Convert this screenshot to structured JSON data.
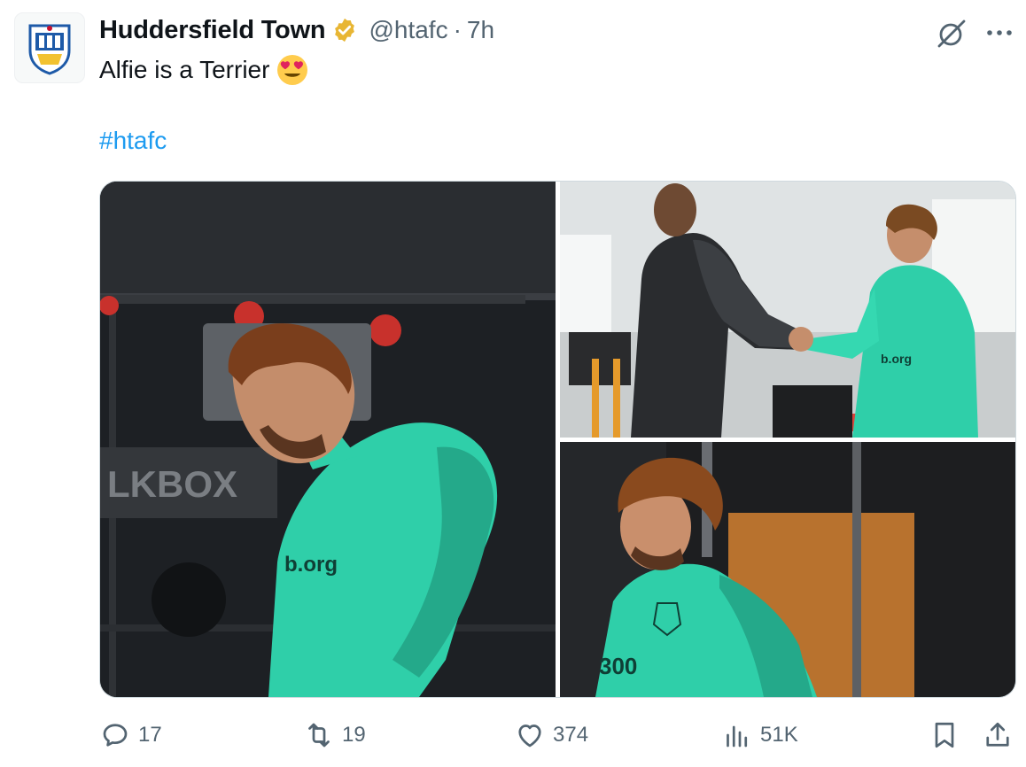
{
  "post": {
    "author_name": "Huddersfield Town",
    "handle": "@htafc",
    "separator": "·",
    "time": "7h",
    "text": "Alfie is a Terrier",
    "emoji": "heart-eyes-emoji",
    "hashtag": "#htafc"
  },
  "media": {
    "photo1_sign": "LKBOX",
    "photo1_shirt": "b.org",
    "photo2_shirt": "b.org",
    "photo3_shirt": "300"
  },
  "actions": {
    "replies": "17",
    "reposts": "19",
    "likes": "374",
    "views": "51K"
  },
  "colors": {
    "link": "#1d9bf0",
    "secondary_text": "#536471",
    "verified_badge": "#e8b634",
    "kit_teal": "#2fcfa9"
  }
}
